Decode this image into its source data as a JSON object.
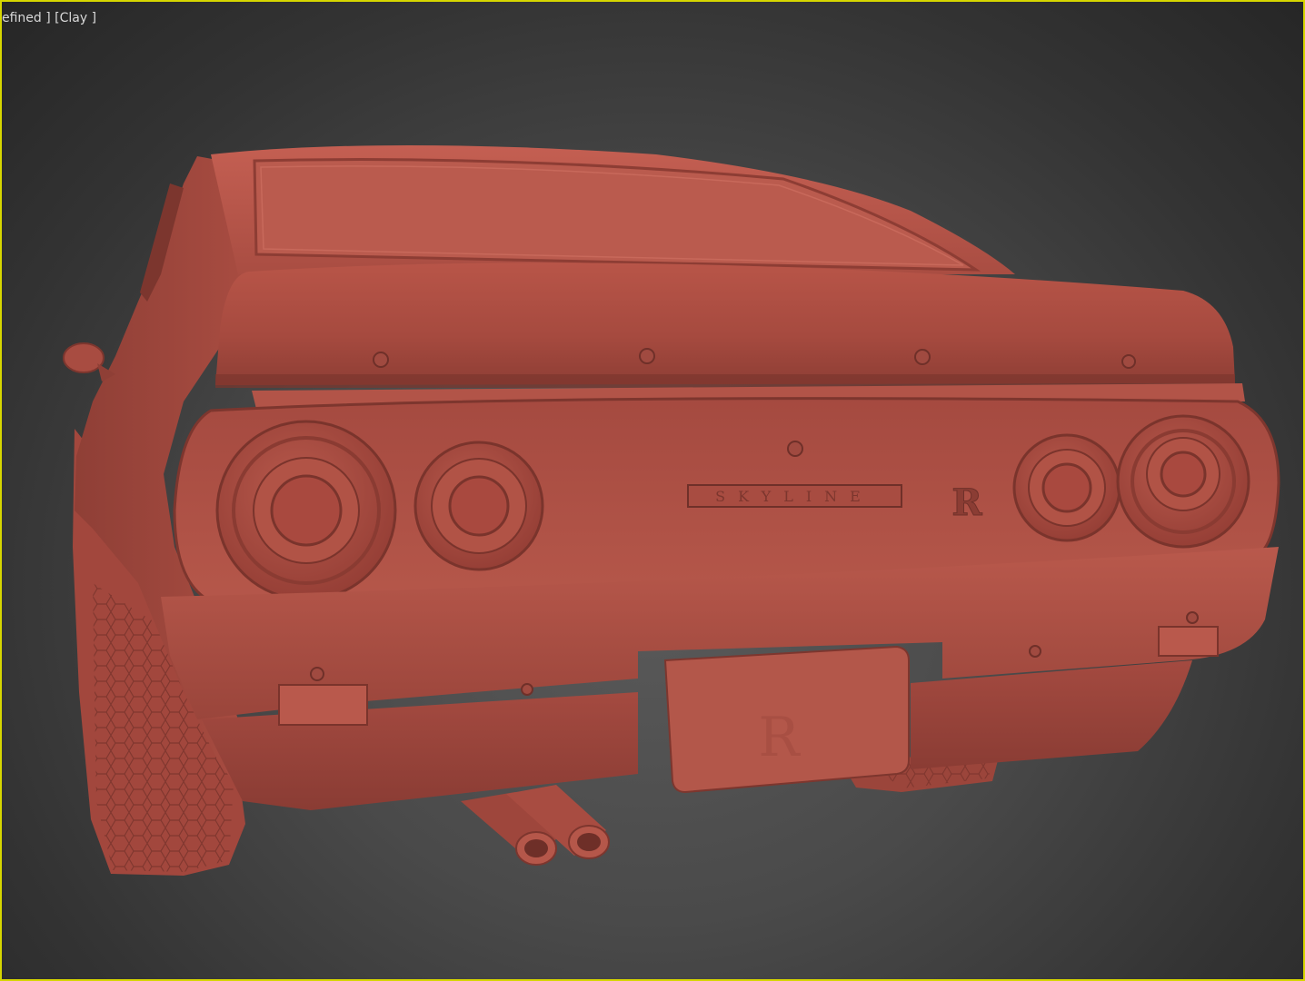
{
  "viewport": {
    "label_parts": [
      "efined ]",
      " [Clay ]"
    ],
    "active_border_color": "#d6d600",
    "background_color": "#4a4a4a"
  },
  "model": {
    "material": "clay",
    "clay_color": "#b5574a",
    "badge_text": "SKYLINE",
    "emblem_text": "R"
  },
  "icons": {
    "viewport_shading": "clay-shading-icon"
  }
}
